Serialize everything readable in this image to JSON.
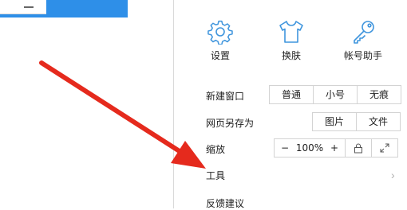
{
  "browser": {
    "tab_minimize_glyph": "—"
  },
  "quick_actions": [
    {
      "label": "设置",
      "icon": "gear-icon"
    },
    {
      "label": "换肤",
      "icon": "shirt-icon"
    },
    {
      "label": "帐号助手",
      "icon": "key-icon"
    }
  ],
  "new_window": {
    "label": "新建窗口",
    "options": [
      "普通",
      "小号",
      "无痕"
    ]
  },
  "save_page": {
    "label": "网页另存为",
    "options": [
      "图片",
      "文件"
    ]
  },
  "zoom": {
    "label": "缩放",
    "minus": "−",
    "value": "100%",
    "plus": "+"
  },
  "tools": {
    "label": "工具",
    "chevron": "›"
  },
  "feedback": {
    "label": "反馈建议"
  },
  "colors": {
    "accent": "#2e8fe8",
    "icon_stroke": "#3f95dd",
    "arrow": "#e52a1d"
  }
}
